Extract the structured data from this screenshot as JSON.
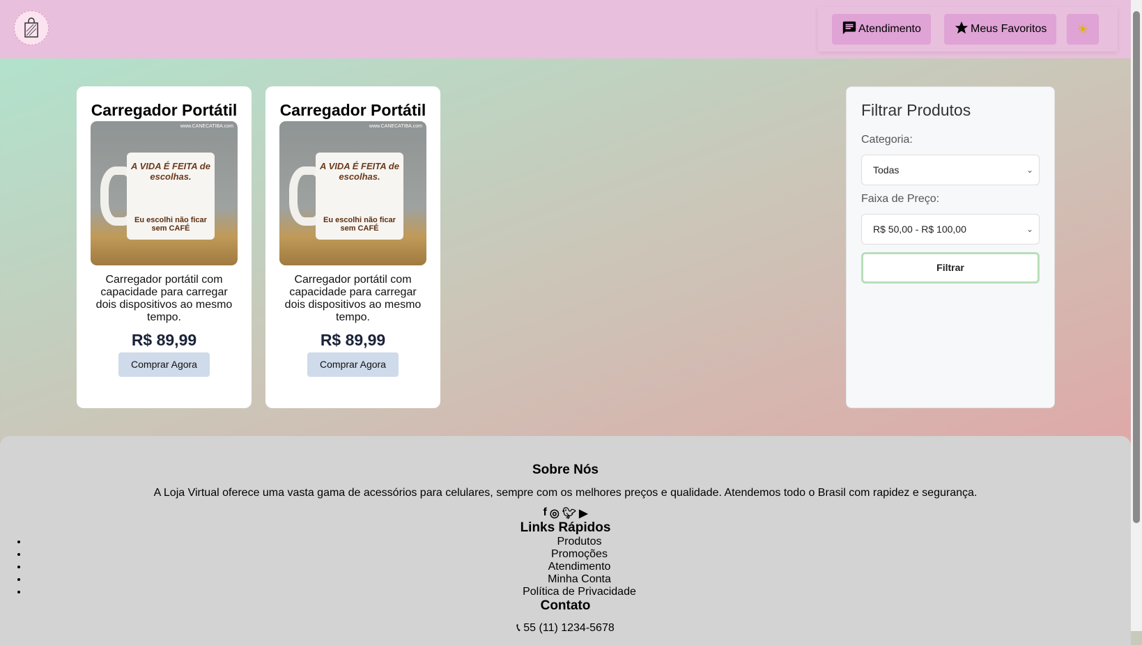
{
  "header": {
    "atendimento": "Atendimento",
    "favoritos": "Meus Favoritos"
  },
  "products": [
    {
      "name": "Carregador Portátil",
      "image_watermark": "www.CANECATIBA.com",
      "mug_text": "A VIDA É FEITA de escolhas.",
      "mug_text2": "Eu escolhi não ficar sem CAFÉ",
      "description": "Carregador portátil com capacidade para carregar dois dispositivos ao mesmo tempo.",
      "price": "R$ 89,99",
      "buy": "Comprar Agora"
    },
    {
      "name": "Carregador Portátil",
      "image_watermark": "www.CANECATIBA.com",
      "mug_text": "A VIDA É FEITA de escolhas.",
      "mug_text2": "Eu escolhi não ficar sem CAFÉ",
      "description": "Carregador portátil com capacidade para carregar dois dispositivos ao mesmo tempo.",
      "price": "R$ 89,99",
      "buy": "Comprar Agora"
    }
  ],
  "filter": {
    "title": "Filtrar Produtos",
    "category_label": "Categoria:",
    "category_value": "Todas",
    "price_label": "Faixa de Preço:",
    "price_value": "R$ 50,00 - R$ 100,00",
    "button": "Filtrar"
  },
  "footer": {
    "about_title": "Sobre Nós",
    "about_text": "A Loja Virtual oferece uma vasta gama de acessórios para celulares, sempre com os melhores preços e qualidade. Atendemos todo o Brasil com rapidez e segurança.",
    "links_title": "Links Rápidos",
    "links": [
      "Produtos",
      "Promoções",
      "Atendimento",
      "Minha Conta",
      "Política de Privacidade"
    ],
    "contact_title": "Contato",
    "phone": "55 (11) 1234-5678"
  }
}
